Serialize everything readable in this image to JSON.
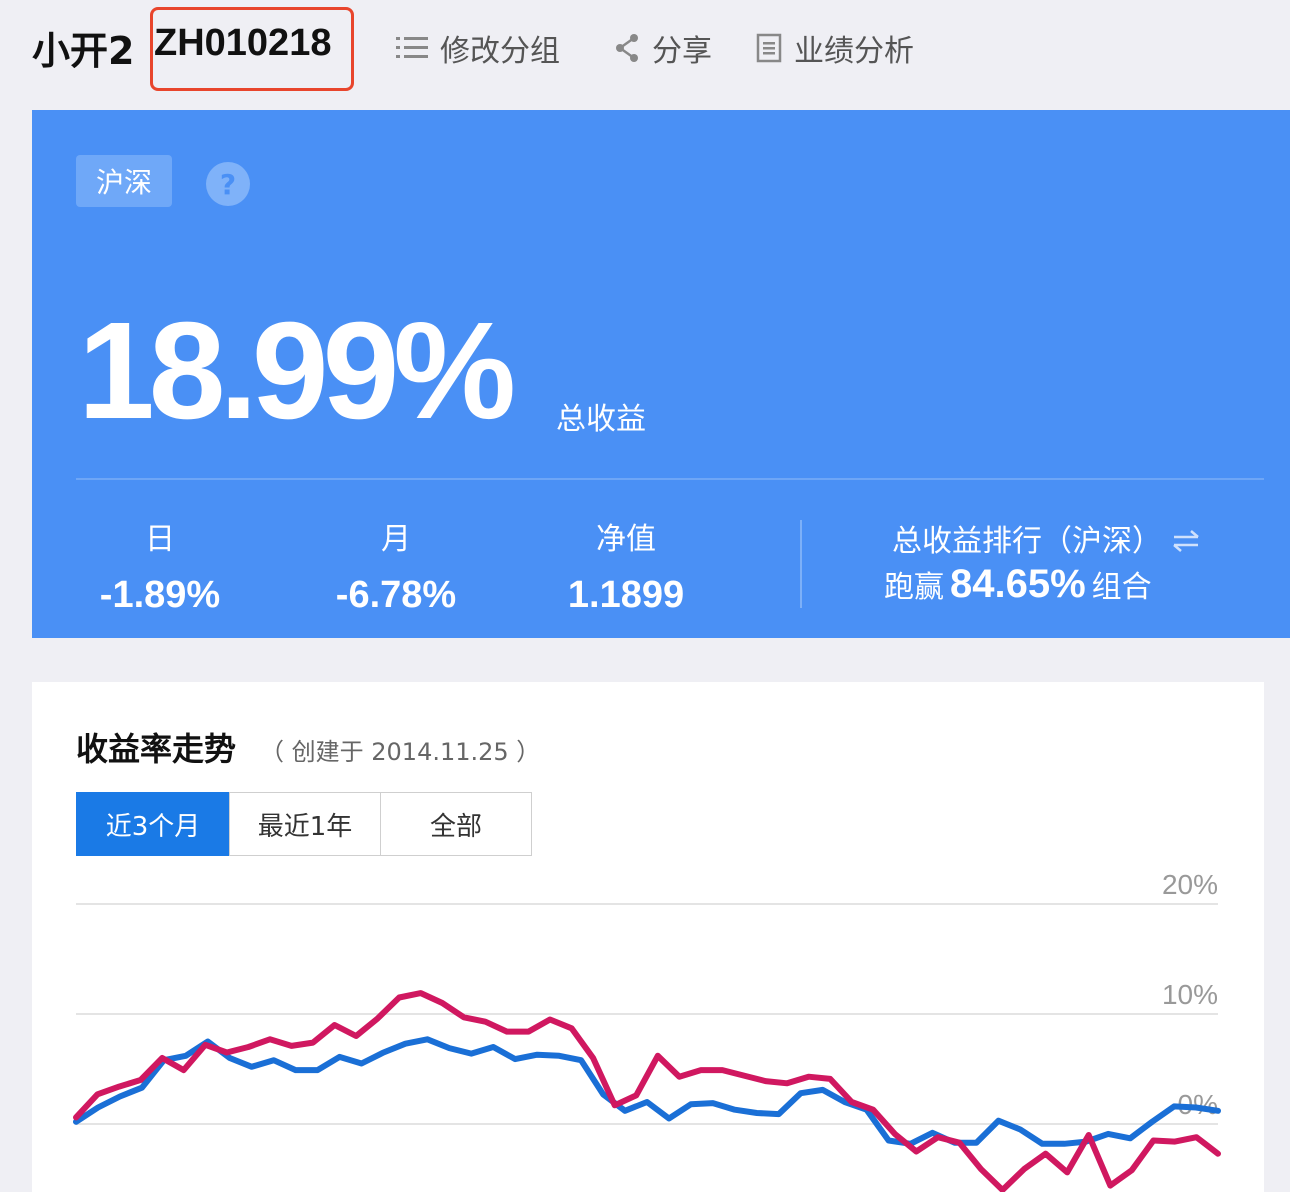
{
  "header": {
    "name": "小开2",
    "code": "ZH010218",
    "edit_group": "修改分组",
    "share": "分享",
    "performance": "业绩分析"
  },
  "summary": {
    "market_tag": "沪深",
    "help": "?",
    "total_return": "18.99%",
    "total_return_label": "总收益",
    "day_label": "日",
    "day_value": "-1.89%",
    "month_label": "月",
    "month_value": "-6.78%",
    "nav_label": "净值",
    "nav_value": "1.1899",
    "rank_title": "总收益排行（沪深）",
    "rank_prefix": "跑赢",
    "rank_value": "84.65%",
    "rank_suffix": "组合"
  },
  "chart_section": {
    "title": "收益率走势",
    "created": "（ 创建于 2014.11.25 ）",
    "tabs": [
      "近3个月",
      "最近1年",
      "全部"
    ],
    "active_tab": 0
  },
  "colors": {
    "accent_blue": "#4a90f5",
    "portfolio_line": "#1a6fd6",
    "benchmark_line": "#d01860",
    "highlight_box": "#e8452c"
  },
  "chart_data": {
    "type": "line",
    "ylim": [
      -5,
      20
    ],
    "yticks": [
      "20%",
      "10%",
      "0%"
    ],
    "ytick_values": [
      20,
      10,
      0
    ],
    "grid": true,
    "series": [
      {
        "color": "#1a6fd6",
        "values": [
          0.2,
          1.5,
          2.5,
          3.3,
          5.8,
          6.2,
          7.5,
          6.0,
          5.2,
          5.8,
          4.9,
          4.9,
          6.1,
          5.5,
          6.5,
          7.3,
          7.7,
          6.9,
          6.4,
          7.0,
          5.9,
          6.3,
          6.2,
          5.8,
          2.7,
          1.2,
          2.0,
          0.5,
          1.8,
          1.9,
          1.3,
          1.0,
          0.9,
          2.8,
          3.1,
          2.0,
          1.3,
          -1.5,
          -1.8,
          -0.8,
          -1.7,
          -1.7,
          0.3,
          -0.5,
          -1.8,
          -1.8,
          -1.6,
          -0.9,
          -1.3,
          0.2,
          1.6,
          1.5,
          1.2
        ]
      },
      {
        "color": "#d01860",
        "values": [
          0.6,
          2.7,
          3.4,
          4.0,
          6.0,
          4.9,
          7.2,
          6.5,
          7.0,
          7.7,
          7.1,
          7.4,
          9.0,
          8.0,
          9.6,
          11.5,
          11.9,
          11.0,
          9.7,
          9.3,
          8.4,
          8.4,
          9.5,
          8.7,
          6.0,
          1.7,
          2.6,
          6.2,
          4.3,
          4.9,
          4.9,
          4.4,
          3.9,
          3.7,
          4.3,
          4.1,
          2.0,
          1.3,
          -0.9,
          -2.5,
          -1.2,
          -1.7,
          -4.1,
          -6.0,
          -4.1,
          -2.7,
          -4.4,
          -1.0,
          -5.6,
          -4.2,
          -1.5,
          -1.6,
          -1.2,
          -2.7
        ]
      }
    ]
  }
}
